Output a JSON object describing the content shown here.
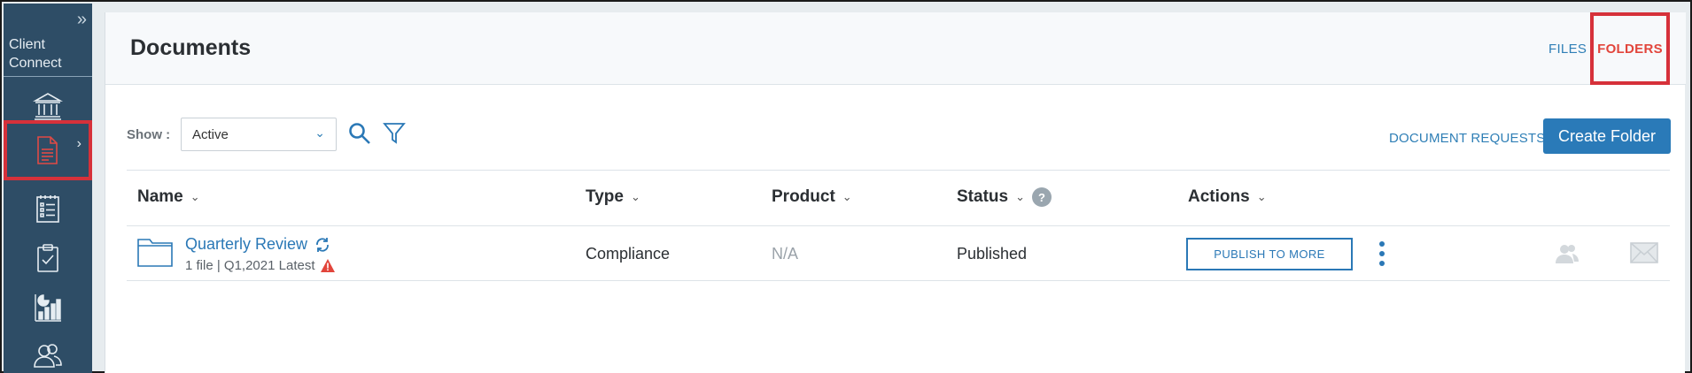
{
  "sidebar": {
    "toggle_glyph": "»",
    "brand_line1": "Client",
    "brand_line2": "Connect",
    "items": [
      {
        "name": "bank-icon"
      },
      {
        "name": "document-icon",
        "active": true
      },
      {
        "name": "checklist-icon"
      },
      {
        "name": "clipboard-check-icon"
      },
      {
        "name": "bar-chart-icon"
      },
      {
        "name": "users-icon"
      }
    ]
  },
  "header": {
    "title": "Documents",
    "tabs": [
      {
        "label": "FILES"
      },
      {
        "label": "FOLDERS",
        "active": true
      }
    ]
  },
  "toolbar": {
    "show_label": "Show :",
    "show_value": "Active",
    "document_requests": "DOCUMENT REQUESTS",
    "create_folder": "Create Folder"
  },
  "table": {
    "columns": [
      "Name",
      "Type",
      "Product",
      "Status",
      "Actions"
    ],
    "status_help": "?",
    "rows": [
      {
        "name": "Quarterly Review",
        "meta": "1 file | Q1,2021 Latest",
        "type": "Compliance",
        "product": "N/A",
        "status": "Published",
        "action": "PUBLISH TO MORE"
      }
    ]
  },
  "colors": {
    "sidebar_bg": "#2e4d66",
    "accent_blue": "#2a7ab8",
    "highlight_red": "#d6313a",
    "warning_red": "#e2453b"
  }
}
